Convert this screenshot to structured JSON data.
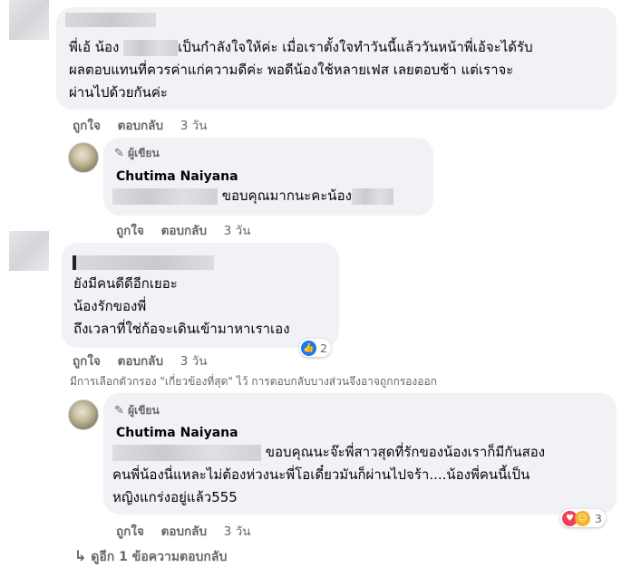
{
  "comments": [
    {
      "lines": [
        "พี่เอ้ น้อง",
        "เป็นกำลังใจให้ค่ะ เมื่อเราตั้งใจทำวันนี้แล้ววันหน้าพี่เอ้จะได้รับ",
        "ผลตอบแทนที่ควรค่าแก่ความดีค่ะ พอดีน้องใช้หลายเฟส เลยตอบช้า แต่เราจะ",
        "ผ่านไปด้วยกันค่ะ"
      ],
      "like": "ถูกใจ",
      "reply": "ตอบกลับ",
      "time": "3 วัน"
    },
    {
      "badge": "ผู้เขียน",
      "author": "Chutima Naiyana",
      "lines": [
        "ขอบคุณมากนะคะน้อง"
      ],
      "like": "ถูกใจ",
      "reply": "ตอบกลับ",
      "time": "3 วัน"
    },
    {
      "lines": [
        "ยังมีคนดีดีอีกเยอะ",
        "น้องรักของพี่",
        "ถึงเวลาที่ใช่ก้อจะเดินเข้ามาหาเราเอง"
      ],
      "like": "ถูกใจ",
      "reply": "ตอบกลับ",
      "time": "3 วัน",
      "reaction_count": "2"
    },
    {
      "badge": "ผู้เขียน",
      "author": "Chutima Naiyana",
      "lines": [
        "ขอบคุณนะจ๊ะพี่สาวสุดที่รักของน้องเราก็มีกันสอง",
        "คนพี่น้องนี่แหละไม่ต้องห่วงนะพี่โอเดี๋ยวมันก็ผ่านไปจร้า....น้องพี่คนนี้เป็น",
        "หญิงแกร่งอยู่แล้ว555"
      ],
      "like": "ถูกใจ",
      "reply": "ตอบกลับ",
      "time": "3 วัน",
      "reaction_count": "3"
    }
  ],
  "filter_note": "มีการเลือกตัวกรอง \"เกี่ยวข้องที่สุด\" ไว้ การตอบกลับบางส่วนจึงอาจถูกกรองออก",
  "more_replies": "ดูอีก 1 ข้อความตอบกลับ",
  "colors": {
    "like_blue": "#1877f2",
    "love_red": "#f33e58",
    "care_yellow": "#f7b125"
  }
}
